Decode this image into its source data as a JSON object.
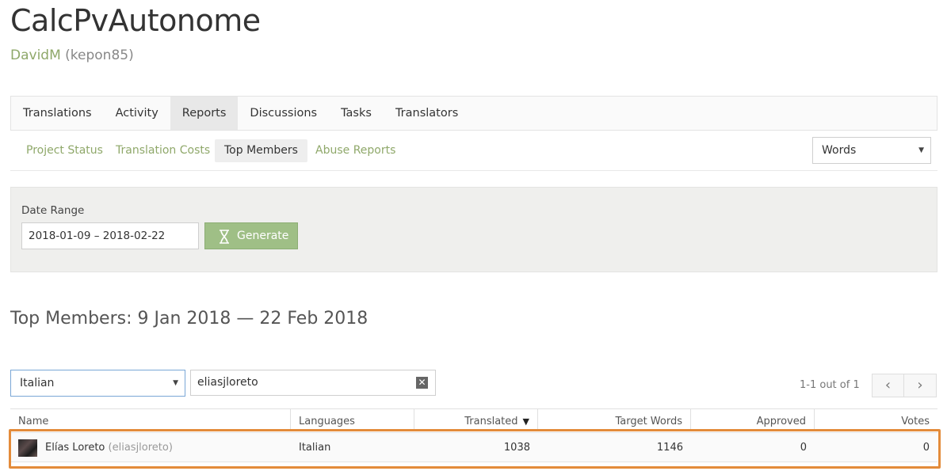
{
  "project": {
    "title": "CalcPvAutonome",
    "owner_name": "DavidM",
    "owner_handle": "(kepon85)"
  },
  "tabs": [
    "Translations",
    "Activity",
    "Reports",
    "Discussions",
    "Tasks",
    "Translators"
  ],
  "active_tab": "Reports",
  "subnav": {
    "links": [
      "Project Status",
      "Translation Costs",
      "Top Members",
      "Abuse Reports"
    ],
    "active": "Top Members",
    "unit_select": "Words"
  },
  "filter_panel": {
    "date_label": "Date Range",
    "date_value": "2018-01-09 – 2018-02-22",
    "generate_label": "Generate"
  },
  "report": {
    "heading": "Top Members: 9 Jan 2018 — 22 Feb 2018",
    "language_filter": "Italian",
    "member_search": "eliasjloreto",
    "pagination_text": "1-1 out of 1",
    "columns": [
      "Name",
      "Languages",
      "Translated",
      "Target Words",
      "Approved",
      "Votes"
    ],
    "sorted_column": "Translated",
    "rows": [
      {
        "name": "Elías Loreto",
        "handle": "(eliasjloreto)",
        "languages": "Italian",
        "translated": "1038",
        "target_words": "1146",
        "approved": "0",
        "votes": "0"
      }
    ]
  },
  "colors": {
    "accent_green": "#8fa86a",
    "button_green": "#9fbf86",
    "highlight_orange": "#e38b3a"
  },
  "icons": {
    "generate": "hourglass-icon",
    "clear": "close-icon",
    "sort": "sort-desc-icon",
    "prev": "chevron-left-icon",
    "next": "chevron-right-icon"
  }
}
